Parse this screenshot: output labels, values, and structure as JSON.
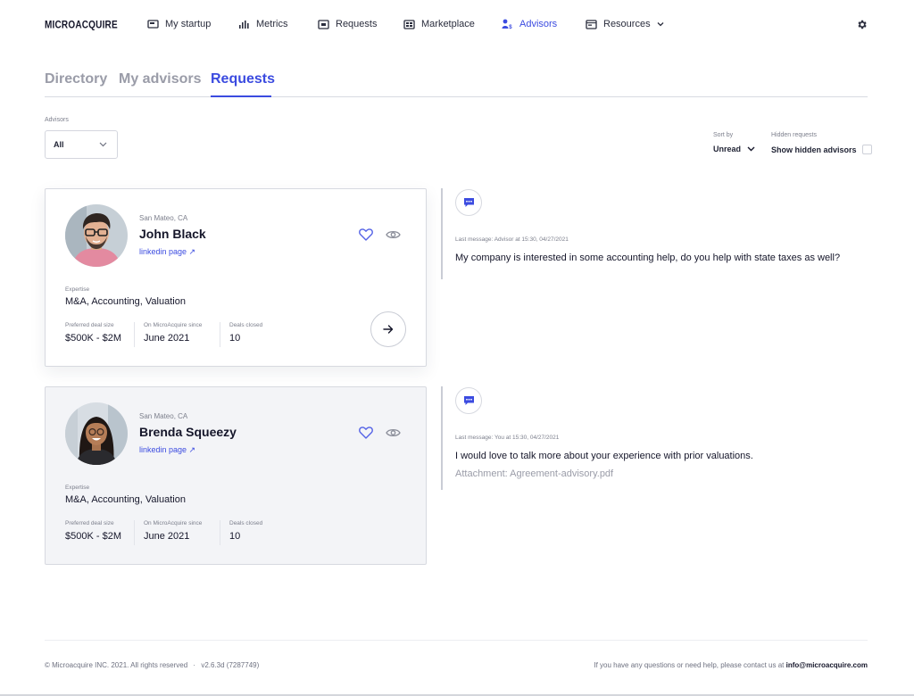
{
  "header": {
    "logo": "MICROACQUIRE",
    "nav": [
      {
        "label": "My startup",
        "icon": "laptop-icon"
      },
      {
        "label": "Metrics",
        "icon": "bars-icon"
      },
      {
        "label": "Requests",
        "icon": "inbox-icon"
      },
      {
        "label": "Marketplace",
        "icon": "grid-icon"
      },
      {
        "label": "Advisors",
        "icon": "advisor-dollar-icon"
      },
      {
        "label": "Resources",
        "icon": "browser-icon"
      }
    ],
    "active_nav": "Advisors",
    "accent_color": "#3b4be0"
  },
  "tabs": [
    {
      "label": "Directory"
    },
    {
      "label": "My advisors"
    },
    {
      "label": "Requests"
    }
  ],
  "active_tab": "Requests",
  "filters": {
    "advisors_label": "Advisors",
    "advisors_value": "All",
    "sort_label": "Sort by",
    "sort_value": "Unread",
    "hidden_label": "Hidden requests",
    "hidden_value": "Show hidden advisors",
    "hidden_checked": false
  },
  "advisors": [
    {
      "location": "San Mateo, CA",
      "name": "John Black",
      "linkedin": "linkedin page ↗",
      "expertise_label": "Expertise",
      "expertise": "M&A, Accounting, Valuation",
      "deal_size_label": "Preferred deal size",
      "deal_size": "$500K - $2M",
      "since_label": "On MicroAcquire since",
      "since": "June 2021",
      "deals_label": "Deals closed",
      "deals": "10",
      "message_meta": "Last message: Advisor at 15:30, 04/27/2021",
      "message": "My company is interested in some accounting help, do you help with state taxes as well?"
    },
    {
      "location": "San Mateo, CA",
      "name": "Brenda Squeezy",
      "linkedin": "linkedin page ↗",
      "expertise_label": "Expertise",
      "expertise": "M&A, Accounting, Valuation",
      "deal_size_label": "Preferred deal size",
      "deal_size": "$500K - $2M",
      "since_label": "On MicroAcquire since",
      "since": "June 2021",
      "deals_label": "Deals closed",
      "deals": "10",
      "message_meta": "Last message: You at 15:30, 04/27/2021",
      "message": "I would love to talk more about your experience with prior valuations.",
      "attachment": "Attachment: Agreement-advisory.pdf"
    }
  ],
  "footer": {
    "copyright": "© Microacquire INC. 2021. All rights reserved",
    "separator": "·",
    "version": "v2.6.3d (7287749)",
    "help_text": "If you have any questions or need help, please contact us at",
    "email": "info@microacquire.com"
  }
}
